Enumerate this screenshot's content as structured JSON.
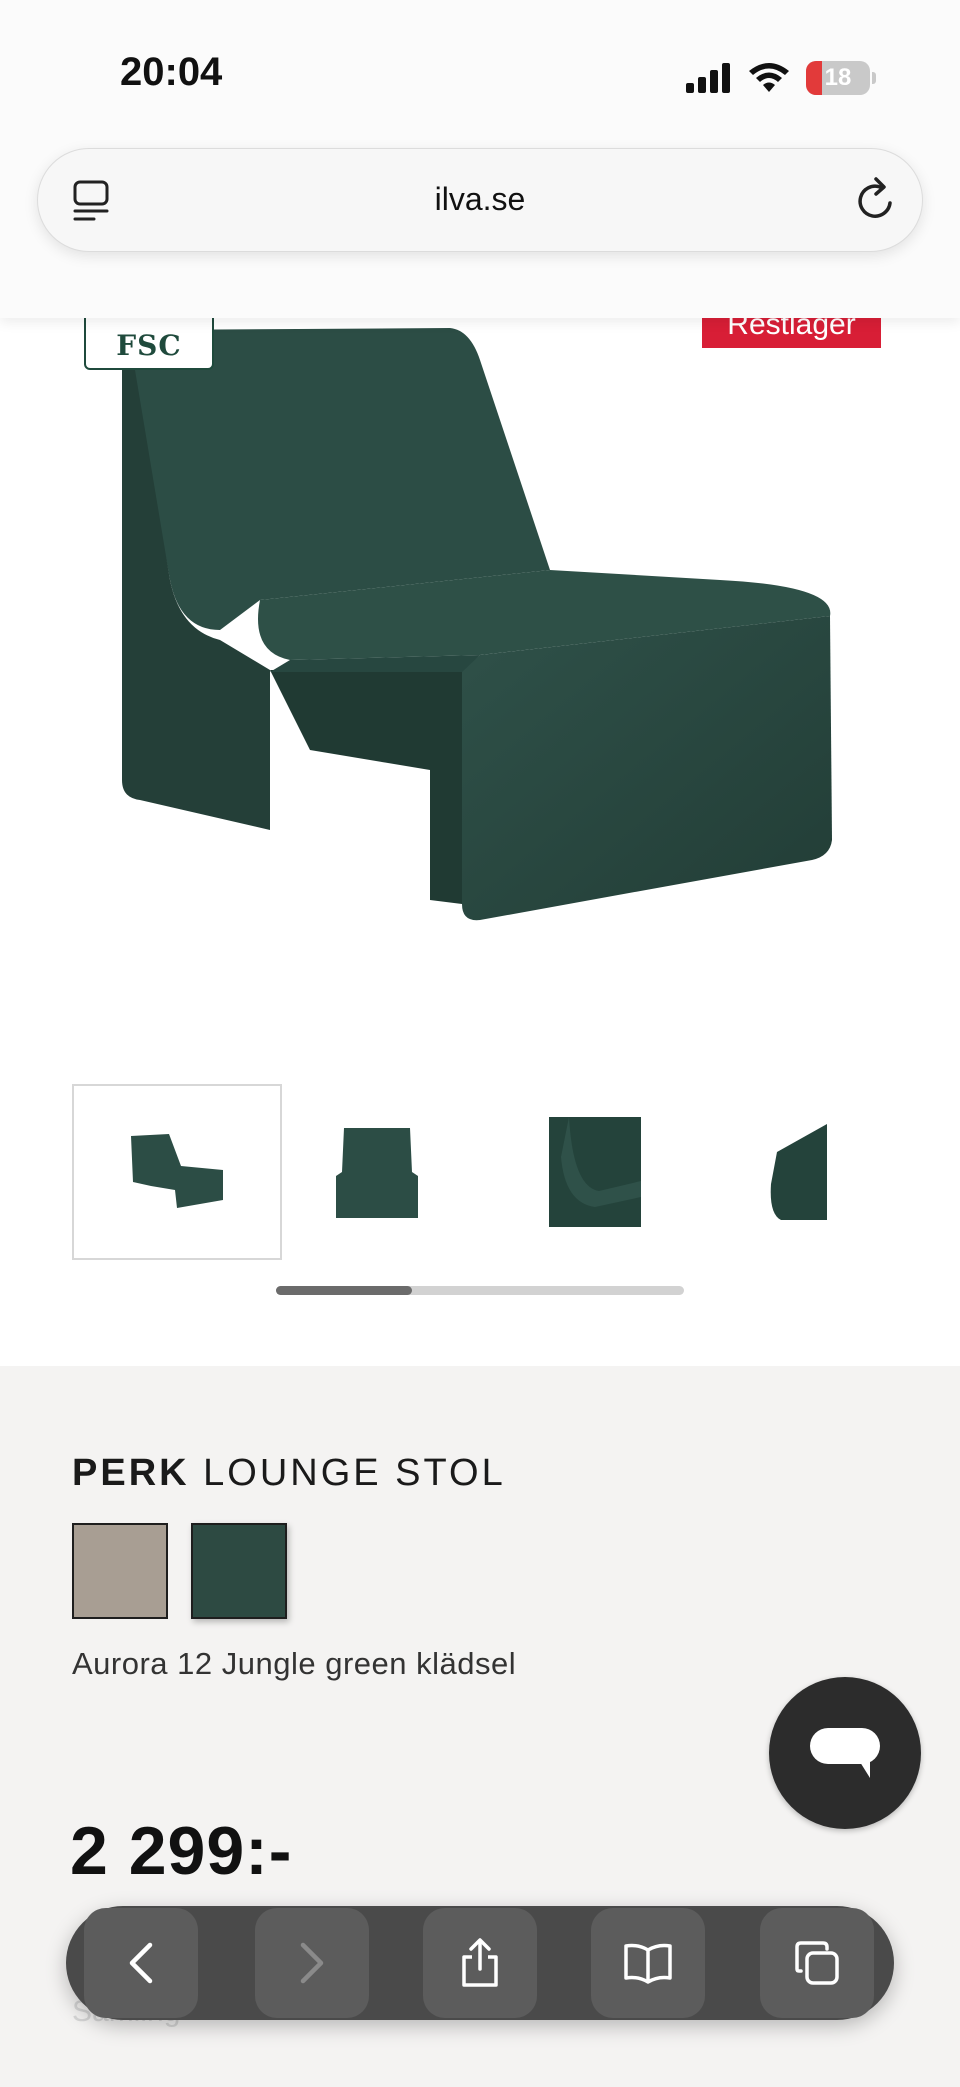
{
  "status_bar": {
    "time": "20:04",
    "battery": "18"
  },
  "browser": {
    "url": "ilva.se"
  },
  "product": {
    "badges": {
      "certification": "FSC",
      "stock": "Restlager"
    },
    "name_bold": "PERK",
    "name_rest": "LOUNGE STOL",
    "swatches": [
      {
        "color": "#a89e93",
        "selected": false
      },
      {
        "color": "#2d4a42",
        "selected": true
      }
    ],
    "variant": "Aurora 12 Jungle green klädsel",
    "price": "2 299:-"
  },
  "gallery": {
    "thumbnail_count": 4,
    "active_index": 0
  },
  "colors": {
    "chair": "#2a4a42",
    "badge_red": "#d81e36"
  },
  "toolbar_icons": [
    "back-icon",
    "forward-icon",
    "share-icon",
    "bookmarks-icon",
    "tabs-icon"
  ]
}
